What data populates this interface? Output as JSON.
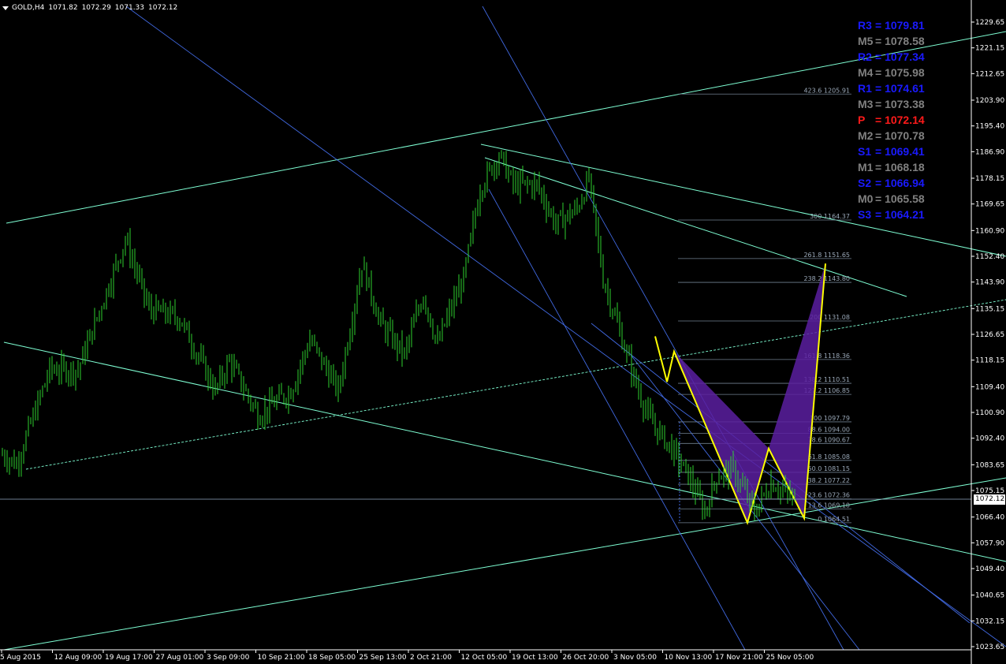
{
  "header": {
    "symbol": "GOLD,H4",
    "open": "1071.82",
    "high": "1072.29",
    "low": "1071.33",
    "close": "1072.12"
  },
  "current_price_tag": "1072.12",
  "pivots": [
    {
      "label": "R3",
      "value": "1079.81",
      "color": "#1a1aff"
    },
    {
      "label": "M5",
      "value": "1078.58",
      "color": "#808080"
    },
    {
      "label": "R2",
      "value": "1077.34",
      "color": "#1a1aff"
    },
    {
      "label": "M4",
      "value": "1075.98",
      "color": "#808080"
    },
    {
      "label": "R1",
      "value": "1074.61",
      "color": "#1a1aff"
    },
    {
      "label": "M3",
      "value": "1073.38",
      "color": "#808080"
    },
    {
      "label": "P",
      "value": "1072.14",
      "color": "#ff1a1a"
    },
    {
      "label": "M2",
      "value": "1070.78",
      "color": "#808080"
    },
    {
      "label": "S1",
      "value": "1069.41",
      "color": "#1a1aff"
    },
    {
      "label": "M1",
      "value": "1068.18",
      "color": "#808080"
    },
    {
      "label": "S2",
      "value": "1066.94",
      "color": "#1a1aff"
    },
    {
      "label": "M0",
      "value": "1065.58",
      "color": "#808080"
    },
    {
      "label": "S3",
      "value": "1064.21",
      "color": "#1a1aff"
    }
  ],
  "chart_data": {
    "type": "candlestick",
    "symbol": "GOLD",
    "timeframe": "H4",
    "y_ticks": [
      "1229.65",
      "1221.15",
      "1212.65",
      "1203.90",
      "1195.40",
      "1186.90",
      "1178.15",
      "1169.65",
      "1160.90",
      "1152.40",
      "1143.90",
      "1135.15",
      "1126.65",
      "1118.15",
      "1109.40",
      "1100.90",
      "1092.40",
      "1083.65",
      "1075.15",
      "1066.40",
      "1057.90",
      "1049.40",
      "1040.65",
      "1032.15",
      "1023.65"
    ],
    "ylim": [
      1023.65,
      1229.65
    ],
    "x_ticks": [
      "5 Aug 2015",
      "12 Aug 09:00",
      "19 Aug 17:00",
      "27 Aug 01:00",
      "3 Sep 09:00",
      "10 Sep 21:00",
      "18 Sep 05:00",
      "25 Sep 13:00",
      "2 Oct 21:00",
      "12 Oct 05:00",
      "19 Oct 13:00",
      "26 Oct 20:00",
      "3 Nov 05:00",
      "10 Nov 13:00",
      "17 Nov 21:00",
      "25 Nov 05:00"
    ],
    "current_price": 1072.12,
    "anchor_closes": [
      {
        "bar": 0,
        "close": 1087
      },
      {
        "bar": 6,
        "close": 1084
      },
      {
        "bar": 20,
        "close": 1115
      },
      {
        "bar": 32,
        "close": 1115
      },
      {
        "bar": 52,
        "close": 1158
      },
      {
        "bar": 62,
        "close": 1135
      },
      {
        "bar": 75,
        "close": 1132
      },
      {
        "bar": 90,
        "close": 1108
      },
      {
        "bar": 96,
        "close": 1118
      },
      {
        "bar": 108,
        "close": 1100
      },
      {
        "bar": 122,
        "close": 1108
      },
      {
        "bar": 130,
        "close": 1125
      },
      {
        "bar": 142,
        "close": 1108
      },
      {
        "bar": 152,
        "close": 1150
      },
      {
        "bar": 160,
        "close": 1130
      },
      {
        "bar": 170,
        "close": 1120
      },
      {
        "bar": 178,
        "close": 1140
      },
      {
        "bar": 184,
        "close": 1123
      },
      {
        "bar": 188,
        "close": 1132
      },
      {
        "bar": 195,
        "close": 1145
      },
      {
        "bar": 202,
        "close": 1175
      },
      {
        "bar": 210,
        "close": 1186
      },
      {
        "bar": 216,
        "close": 1176
      },
      {
        "bar": 226,
        "close": 1176
      },
      {
        "bar": 234,
        "close": 1163
      },
      {
        "bar": 243,
        "close": 1168
      },
      {
        "bar": 248,
        "close": 1178
      },
      {
        "bar": 254,
        "close": 1145
      },
      {
        "bar": 260,
        "close": 1130
      },
      {
        "bar": 268,
        "close": 1110
      },
      {
        "bar": 274,
        "close": 1098
      },
      {
        "bar": 282,
        "close": 1090
      },
      {
        "bar": 290,
        "close": 1080
      },
      {
        "bar": 297,
        "close": 1068
      },
      {
        "bar": 302,
        "close": 1080
      },
      {
        "bar": 309,
        "close": 1082
      },
      {
        "bar": 318,
        "close": 1068
      },
      {
        "bar": 325,
        "close": 1078
      },
      {
        "bar": 335,
        "close": 1072
      }
    ],
    "fib_levels": [
      {
        "ratio": "423.6",
        "value": "1205.91"
      },
      {
        "ratio": "300",
        "value": "1164.37"
      },
      {
        "ratio": "261.8",
        "value": "1151.65"
      },
      {
        "ratio": "238.2",
        "value": "1143.80"
      },
      {
        "ratio": "200",
        "value": "1131.08"
      },
      {
        "ratio": "161.8",
        "value": "1118.36"
      },
      {
        "ratio": "138.2",
        "value": "1110.51"
      },
      {
        "ratio": "127.2",
        "value": "1106.85"
      },
      {
        "ratio": "100",
        "value": "1097.79"
      },
      {
        "ratio": "88.6",
        "value": "1094.00"
      },
      {
        "ratio": "78.6",
        "value": "1090.67"
      },
      {
        "ratio": "61.8",
        "value": "1085.08"
      },
      {
        "ratio": "50.0",
        "value": "1081.15"
      },
      {
        "ratio": "38.2",
        "value": "1077.22"
      },
      {
        "ratio": "23.6",
        "value": "1072.36"
      },
      {
        "ratio": "13.6",
        "value": "1069.10"
      },
      {
        "ratio": "0",
        "value": "1064.51"
      }
    ],
    "pattern_points": [
      {
        "bar": 276,
        "price": 1126
      },
      {
        "bar": 281,
        "price": 1111
      },
      {
        "bar": 284,
        "price": 1121
      },
      {
        "bar": 315,
        "price": 1064.5
      },
      {
        "bar": 324,
        "price": 1089
      },
      {
        "bar": 339,
        "price": 1066
      },
      {
        "bar": 348,
        "price": 1150
      }
    ],
    "colors": {
      "background": "#000000",
      "candle": "#2ed12e",
      "channel": "#7fffd4",
      "trend_blue": "#4169e1",
      "pattern_line": "#ffff00",
      "pattern_fill": "#5a1fa0",
      "fib_line": "#708090",
      "axis_text": "#ffffff"
    }
  }
}
